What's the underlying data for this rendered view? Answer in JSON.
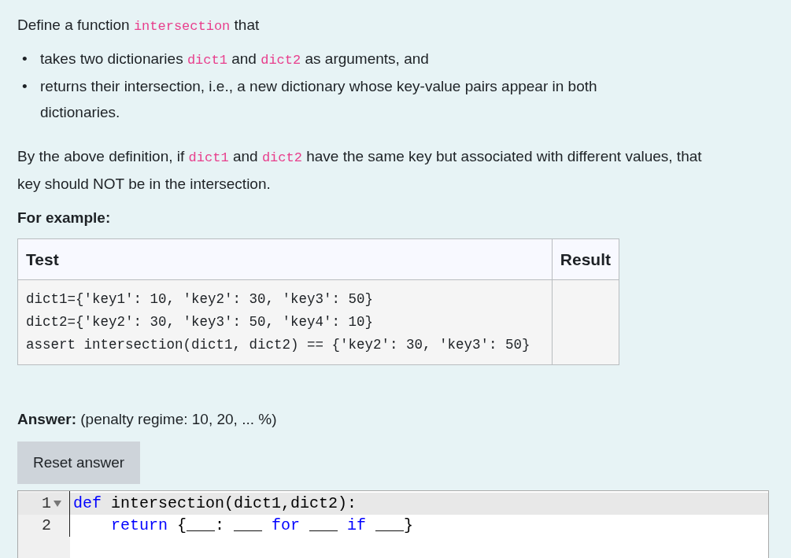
{
  "intro": [
    {
      "kind": "text",
      "text": "Define a function "
    },
    {
      "kind": "code",
      "text": "intersection"
    },
    {
      "kind": "text",
      "text": " that"
    }
  ],
  "bullets": [
    {
      "marker": "•",
      "parts": [
        {
          "kind": "text",
          "text": "takes two dictionaries "
        },
        {
          "kind": "code",
          "text": "dict1"
        },
        {
          "kind": "text",
          "text": " and "
        },
        {
          "kind": "code",
          "text": "dict2"
        },
        {
          "kind": "text",
          "text": " as arguments, and"
        }
      ]
    },
    {
      "marker": "•",
      "parts": [
        {
          "kind": "text",
          "text": "returns their intersection, i.e., a new dictionary whose key-value pairs appear in both dictionaries."
        }
      ]
    }
  ],
  "note": [
    {
      "kind": "text",
      "text": "By the above definition, if "
    },
    {
      "kind": "code",
      "text": "dict1"
    },
    {
      "kind": "text",
      "text": " and "
    },
    {
      "kind": "code",
      "text": "dict2"
    },
    {
      "kind": "text",
      "text": " have the same key but associated with different values, that key should NOT be in the intersection."
    }
  ],
  "example_heading": "For example:",
  "table": {
    "columns": [
      "Test",
      "Result"
    ],
    "rows": [
      {
        "test": [
          "dict1={'key1': 10, 'key2': 30, 'key3': 50}",
          "dict2={'key2': 30, 'key3': 50, 'key4': 10}",
          "assert intersection(dict1, dict2) == {'key2': 30, 'key3': 50}"
        ]
      }
    ]
  },
  "answer_label": "**Answer:** (penalty regime: 10, 20, ... %)",
  "reset_button": "Reset answer",
  "editor": {
    "lines": [
      {
        "number": "1",
        "active": true,
        "foldable": true,
        "tokens": [
          {
            "kind": "keyword",
            "text": "def"
          },
          {
            "kind": "plain",
            "text": " intersection(dict1,dict2):"
          }
        ]
      },
      {
        "number": "2",
        "active": false,
        "foldable": false,
        "tokens": [
          {
            "kind": "keyword",
            "text": "    return"
          },
          {
            "kind": "plain",
            "text": " {___: ___ "
          },
          {
            "kind": "keyword",
            "text": "for"
          },
          {
            "kind": "plain",
            "text": " ___ "
          },
          {
            "kind": "keyword",
            "text": "if"
          },
          {
            "kind": "plain",
            "text": " ___}"
          }
        ]
      }
    ]
  }
}
